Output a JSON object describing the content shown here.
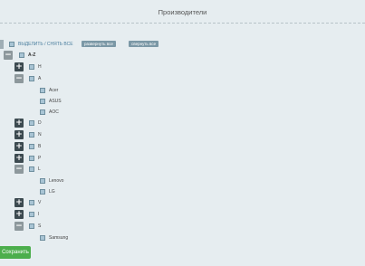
{
  "header": {
    "title": "Производители"
  },
  "toolbar": {
    "select_all_label": "ВЫДЕЛИТЬ / СНЯТЬ ВСЕ",
    "expand_all_label": "развернуть все",
    "collapse_all_label": "свернуть все"
  },
  "tree": {
    "root_label": "A-Z",
    "groups": [
      {
        "label": "H",
        "expanded": false
      },
      {
        "label": "A",
        "expanded": true,
        "items": [
          "Acer",
          "ASUS",
          "AOC"
        ]
      },
      {
        "label": "D",
        "expanded": false
      },
      {
        "label": "N",
        "expanded": false
      },
      {
        "label": "B",
        "expanded": false
      },
      {
        "label": "P",
        "expanded": false
      },
      {
        "label": "L",
        "expanded": true,
        "items": [
          "Lenovo",
          "LG"
        ]
      },
      {
        "label": "V",
        "expanded": false
      },
      {
        "label": "I",
        "expanded": false
      },
      {
        "label": "S",
        "expanded": true,
        "items": [
          "Samsung"
        ]
      }
    ]
  },
  "footer": {
    "save_label": "Сохранить"
  }
}
